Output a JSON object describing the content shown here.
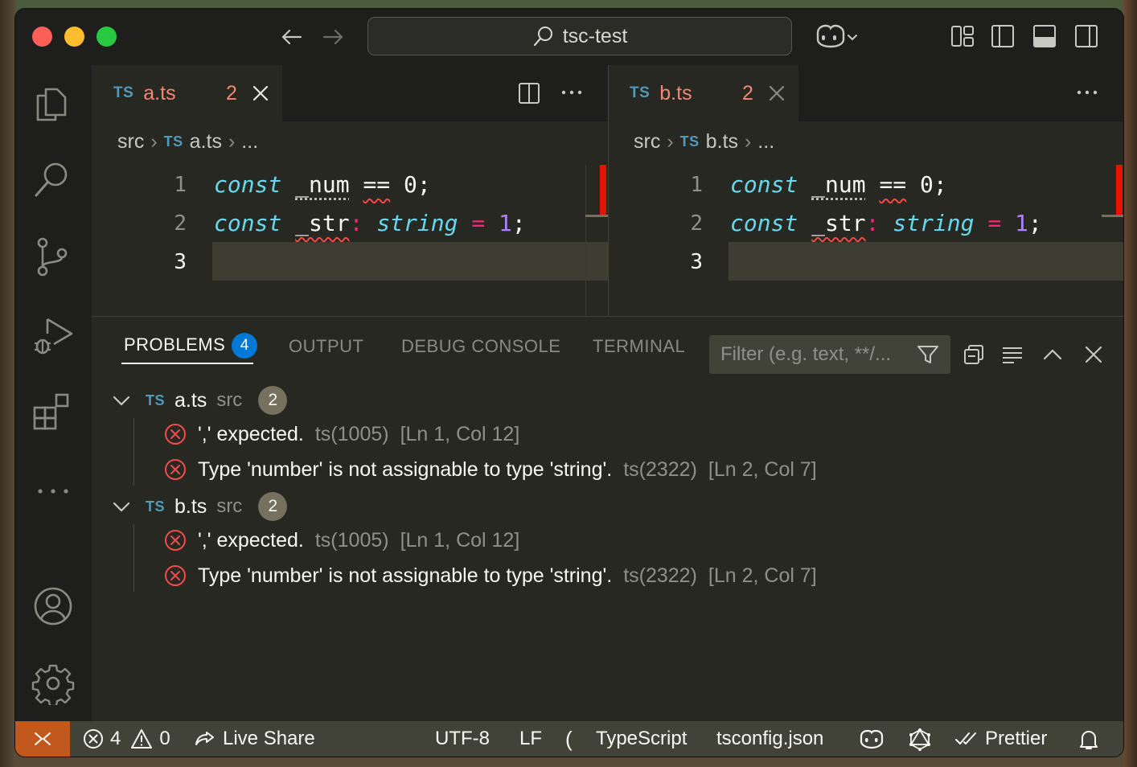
{
  "titlebar": {
    "search_text": "tsc-test"
  },
  "tabs": {
    "left": {
      "badge": "TS",
      "name": "a.ts",
      "count": "2"
    },
    "right": {
      "badge": "TS",
      "name": "b.ts",
      "count": "2"
    }
  },
  "breadcrumbs": {
    "left": {
      "folder": "src",
      "badge": "TS",
      "file": "a.ts",
      "more": "..."
    },
    "right": {
      "folder": "src",
      "badge": "TS",
      "file": "b.ts",
      "more": "..."
    }
  },
  "code": {
    "line_numbers": [
      "1",
      "2",
      "3"
    ],
    "line1": {
      "kw": "const",
      "id": "_num",
      "op": "==",
      "val": "0;"
    },
    "line2": {
      "kw": "const",
      "id": "_str",
      "colon": ":",
      "type": "string",
      "eq": "=",
      "num": "1",
      "semi": ";"
    }
  },
  "panel": {
    "tabs": [
      "PROBLEMS",
      "OUTPUT",
      "DEBUG CONSOLE",
      "TERMINAL"
    ],
    "problems_count": "4",
    "filter_placeholder": "Filter (e.g. text, **/..."
  },
  "problems": [
    {
      "badge": "TS",
      "file": "a.ts",
      "dir": "src",
      "count": "2",
      "errors": [
        {
          "message": "',' expected.",
          "source": "ts(1005)",
          "location": "[Ln 1, Col 12]"
        },
        {
          "message": "Type 'number' is not assignable to type 'string'.",
          "source": "ts(2322)",
          "location": "[Ln 2, Col 7]"
        }
      ]
    },
    {
      "badge": "TS",
      "file": "b.ts",
      "dir": "src",
      "count": "2",
      "errors": [
        {
          "message": "',' expected.",
          "source": "ts(1005)",
          "location": "[Ln 1, Col 12]"
        },
        {
          "message": "Type 'number' is not assignable to type 'string'.",
          "source": "ts(2322)",
          "location": "[Ln 2, Col 7]"
        }
      ]
    }
  ],
  "statusbar": {
    "errors": "4",
    "warnings": "0",
    "live_share": "Live Share",
    "encoding": "UTF-8",
    "eol": "LF",
    "language": "TypeScript",
    "tsconfig": "tsconfig.json",
    "prettier": "Prettier"
  },
  "colors": {
    "error": "#f14c4c",
    "accent": "#0078d4",
    "remote": "#c2581c"
  }
}
